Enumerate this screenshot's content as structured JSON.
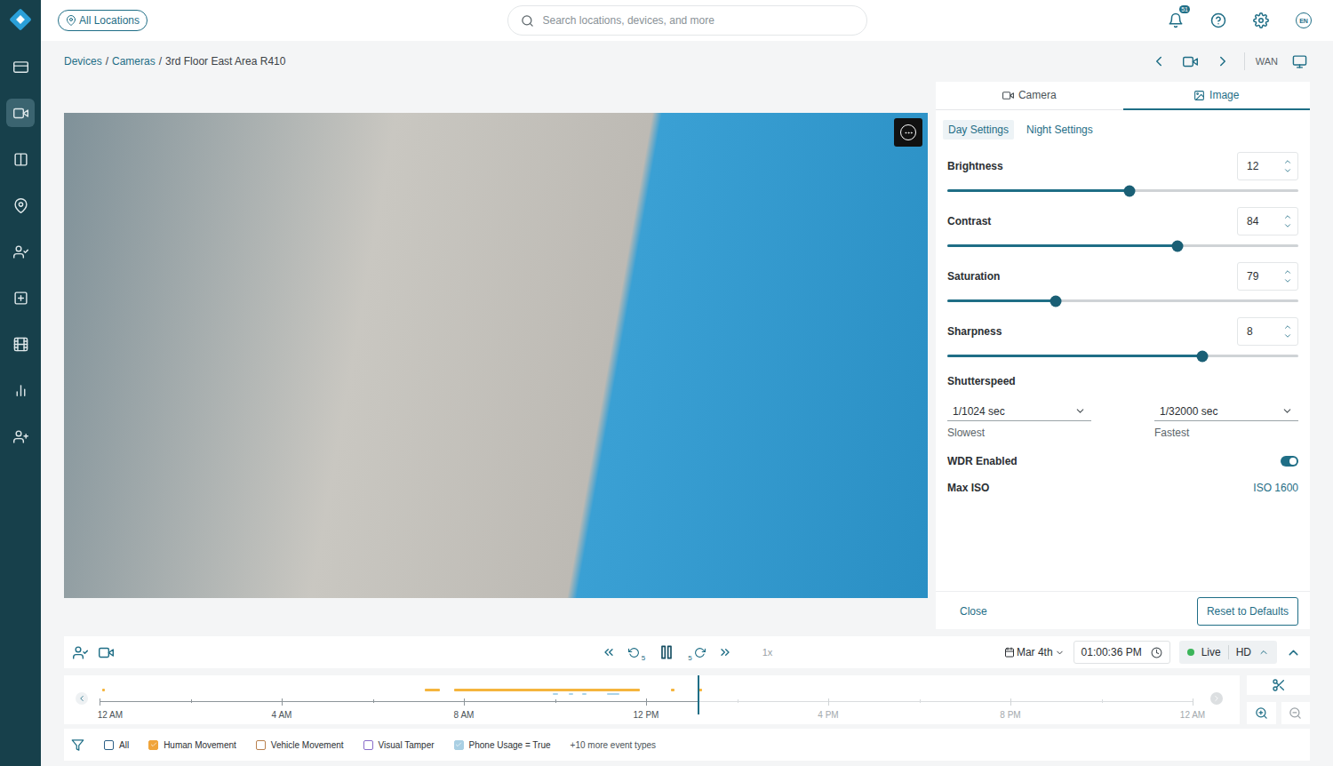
{
  "sidebar": {
    "items": [
      {
        "selected": false
      },
      {
        "selected": true
      },
      {
        "selected": false
      },
      {
        "selected": false
      },
      {
        "selected": false
      },
      {
        "selected": false
      },
      {
        "selected": false
      },
      {
        "selected": false
      },
      {
        "selected": false
      }
    ]
  },
  "topbar": {
    "location_button": "All Locations",
    "search": {
      "placeholder": "Search locations, devices, and more"
    },
    "notifications": "51",
    "language": "EN"
  },
  "breadcrumb": {
    "items": [
      "Devices",
      "Cameras",
      "3rd Floor East Area R410"
    ],
    "separator": "/"
  },
  "device_nav": {
    "network": "WAN"
  },
  "panel": {
    "tabs": [
      {
        "label": "Camera",
        "selected": false
      },
      {
        "label": "Image",
        "selected": true
      }
    ],
    "subtabs": [
      {
        "label": "Day Settings",
        "selected": true
      },
      {
        "label": "Night Settings",
        "selected": false
      }
    ],
    "sliders": [
      {
        "label": "Brightness",
        "value": "12",
        "level": 0.52
      },
      {
        "label": "Contrast",
        "value": "84",
        "level": 0.655
      },
      {
        "label": "Saturation",
        "value": "79",
        "level": 0.31
      },
      {
        "label": "Sharpness",
        "value": "8",
        "level": 0.726
      }
    ],
    "shutterspeed": {
      "label": "Shutterspeed",
      "fields": [
        {
          "value": "1/1024 sec",
          "caption": "Slowest"
        },
        {
          "value": "1/32000 sec",
          "caption": "Fastest"
        }
      ]
    },
    "wdr": {
      "label": "WDR Enabled",
      "on": true
    },
    "max_iso": {
      "label": "Max ISO",
      "value": "ISO 1600"
    },
    "footer": {
      "close": "Close",
      "reset": "Reset to Defaults"
    }
  },
  "player": {
    "skip_seconds": "5",
    "playing": true,
    "speed": {
      "label": "1x",
      "disabled": true
    },
    "date": "Mar 4th",
    "time": "01:00:36 PM",
    "live": {
      "label": "Live",
      "on": true
    },
    "quality": "HD"
  },
  "timeline": {
    "ticks": [
      {
        "label": "12 AM",
        "future": false
      },
      {
        "label": "4 AM",
        "future": false
      },
      {
        "label": "8 AM",
        "future": false
      },
      {
        "label": "12 PM",
        "future": false
      },
      {
        "label": "4 PM",
        "future": true
      },
      {
        "label": "8 PM",
        "future": true
      },
      {
        "label": "12 AM",
        "future": true
      }
    ],
    "playhead": 0.548,
    "nav": {
      "prev_disabled": false,
      "next_disabled": true
    },
    "events": [
      {
        "kind": "human",
        "start": 0.06,
        "end": 0.12,
        "color": "#f5b53d"
      },
      {
        "kind": "human",
        "start": 7.14,
        "end": 7.47,
        "color": "#f5b53d"
      },
      {
        "kind": "human",
        "start": 7.79,
        "end": 11.86,
        "color": "#f5b53d"
      },
      {
        "kind": "human",
        "start": 12.55,
        "end": 12.62,
        "color": "#f5b53d"
      },
      {
        "kind": "human",
        "start": 13.15,
        "end": 13.23,
        "color": "#f5b53d"
      },
      {
        "kind": "phone",
        "start": 9.95,
        "end": 10.07,
        "color": "#a9d3ea"
      },
      {
        "kind": "phone",
        "start": 10.3,
        "end": 10.4,
        "color": "#a9d3ea"
      },
      {
        "kind": "phone",
        "start": 10.6,
        "end": 10.69,
        "color": "#a9d3ea"
      },
      {
        "kind": "phone",
        "start": 11.14,
        "end": 11.41,
        "color": "#a9d3ea"
      }
    ]
  },
  "legend": {
    "items": [
      {
        "label": "All",
        "checked": false,
        "color": "#2c5f86"
      },
      {
        "label": "Human Movement",
        "checked": true,
        "color": "#f0a43a"
      },
      {
        "label": "Vehicle Movement",
        "checked": false,
        "color": "#b9814f"
      },
      {
        "label": "Visual Tamper",
        "checked": false,
        "color": "#8a6cc9"
      },
      {
        "label": "Phone Usage = True",
        "checked": true,
        "color": "#a9cfe3"
      }
    ],
    "more": "+10 more event types"
  }
}
